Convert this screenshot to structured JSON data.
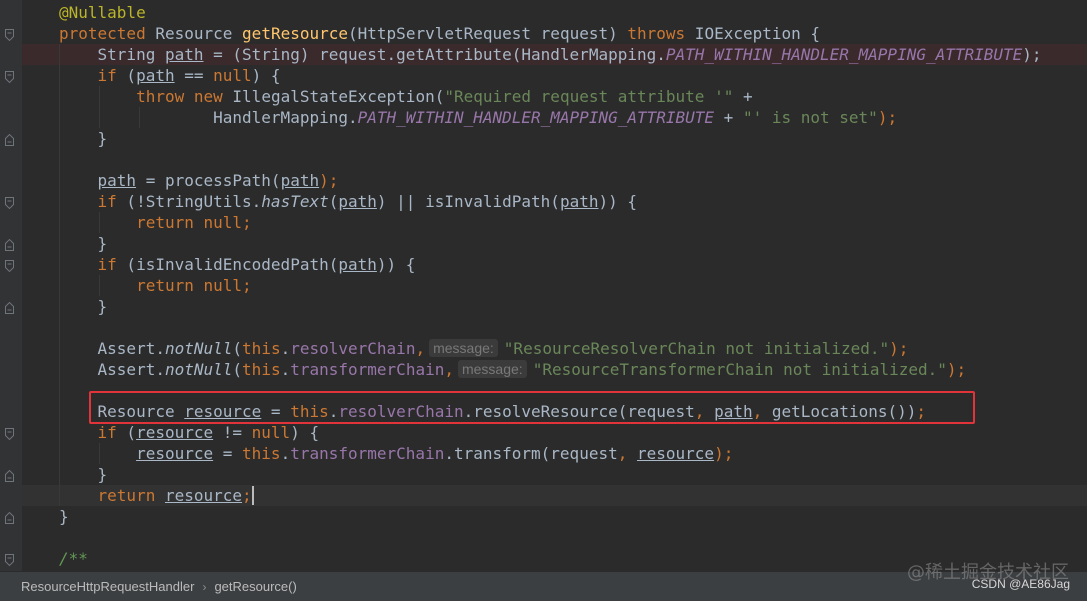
{
  "code": {
    "l1_annotation": "@Nullable",
    "l2_protected": "protected",
    "l2_type": "Resource",
    "l2_method": "getResource",
    "l2_params": "(HttpServletRequest request) ",
    "l2_throws": "throws",
    "l2_exc": " IOException {",
    "l3_string": "String ",
    "l3_path": "path",
    "l3_mid": " = (String) request.getAttribute(HandlerMapping.",
    "l3_const": "PATH_WITHIN_HANDLER_MAPPING_ATTRIBUTE",
    "l3_end": ");",
    "l4_if": "if",
    "l4_open": " (",
    "l4_path": "path",
    "l4_eq": " == ",
    "l4_null": "null",
    "l4_end": ") {",
    "l5_throw": "throw",
    "l5_new": "new",
    "l5_cls": " IllegalStateException(",
    "l5_str": "\"Required request attribute '\"",
    "l5_plus": " +",
    "l6_hm": "HandlerMapping.",
    "l6_const": "PATH_WITHIN_HANDLER_MAPPING_ATTRIBUTE",
    "l6_plus": " + ",
    "l6_str": "\"' is not set\"",
    "l6_end": ");",
    "l7_close": "}",
    "l9_path": "path",
    "l9_rest": " = processPath(",
    "l9_path2": "path",
    "l9_end": ");",
    "l10_if": "if",
    "l10_a": " (!StringUtils.",
    "l10_has": "hasText",
    "l10_b": "(",
    "l10_path": "path",
    "l10_c": ") || isInvalidPath(",
    "l10_path2": "path",
    "l10_d": ")) {",
    "l11_return": "return",
    "l11_null": "null",
    "l11_semi": ";",
    "l12_close": "}",
    "l13_if": "if",
    "l13_a": " (isInvalidEncodedPath(",
    "l13_path": "path",
    "l13_b": ")) {",
    "l14_return": "return",
    "l14_null": "null",
    "l14_semi": ";",
    "l15_close": "}",
    "l17_a": "Assert.",
    "l17_m": "notNull",
    "l17_b": "(",
    "l17_this": "this",
    "l17_dot": ".",
    "l17_field": "resolverChain",
    "l17_comma": ",",
    "l17_hint": "message:",
    "l17_str": "\"ResourceResolverChain not initialized.\"",
    "l17_end": ");",
    "l18_a": "Assert.",
    "l18_m": "notNull",
    "l18_b": "(",
    "l18_this": "this",
    "l18_dot": ".",
    "l18_field": "transformerChain",
    "l18_comma": ",",
    "l18_hint": "message:",
    "l18_str": "\"ResourceTransformerChain not initialized.\"",
    "l18_end": ");",
    "l20_type": "Resource ",
    "l20_var": "resource",
    "l20_eq": " = ",
    "l20_this": "this",
    "l20_dot": ".",
    "l20_field": "resolverChain",
    "l20_a": ".resolveResource(request",
    "l20_comma1": ",",
    "l20_sp1": " ",
    "l20_path": "path",
    "l20_comma2": ",",
    "l20_b": " getLocations())",
    "l20_semi": ";",
    "l21_if": "if",
    "l21_a": " (",
    "l21_var": "resource",
    "l21_b": " != ",
    "l21_null": "null",
    "l21_c": ") {",
    "l22_var": "resource",
    "l22_eq": " = ",
    "l22_this": "this",
    "l22_dot": ".",
    "l22_field": "transformerChain",
    "l22_a": ".transform(request",
    "l22_comma": ",",
    "l22_sp": " ",
    "l22_var2": "resource",
    "l22_end": ");",
    "l23_close": "}",
    "l24_return": "return",
    "l24_var": "resource",
    "l24_semi": ";",
    "l25_close": "}",
    "l27_cmt": "/**"
  },
  "statusbar": {
    "crumb_class": "ResourceHttpRequestHandler",
    "crumb_sep": "›",
    "crumb_method": "getResource()"
  },
  "watermark": {
    "top": "@稀土掘金技术社区",
    "bottom": "CSDN @AE86Jag"
  },
  "colors": {
    "background": "#2b2b2b",
    "keyword": "#cc7832",
    "method": "#ffc66d",
    "string": "#6a8759",
    "field": "#9876aa",
    "annotation": "#bbb529",
    "highlight_box": "#e0343a"
  }
}
